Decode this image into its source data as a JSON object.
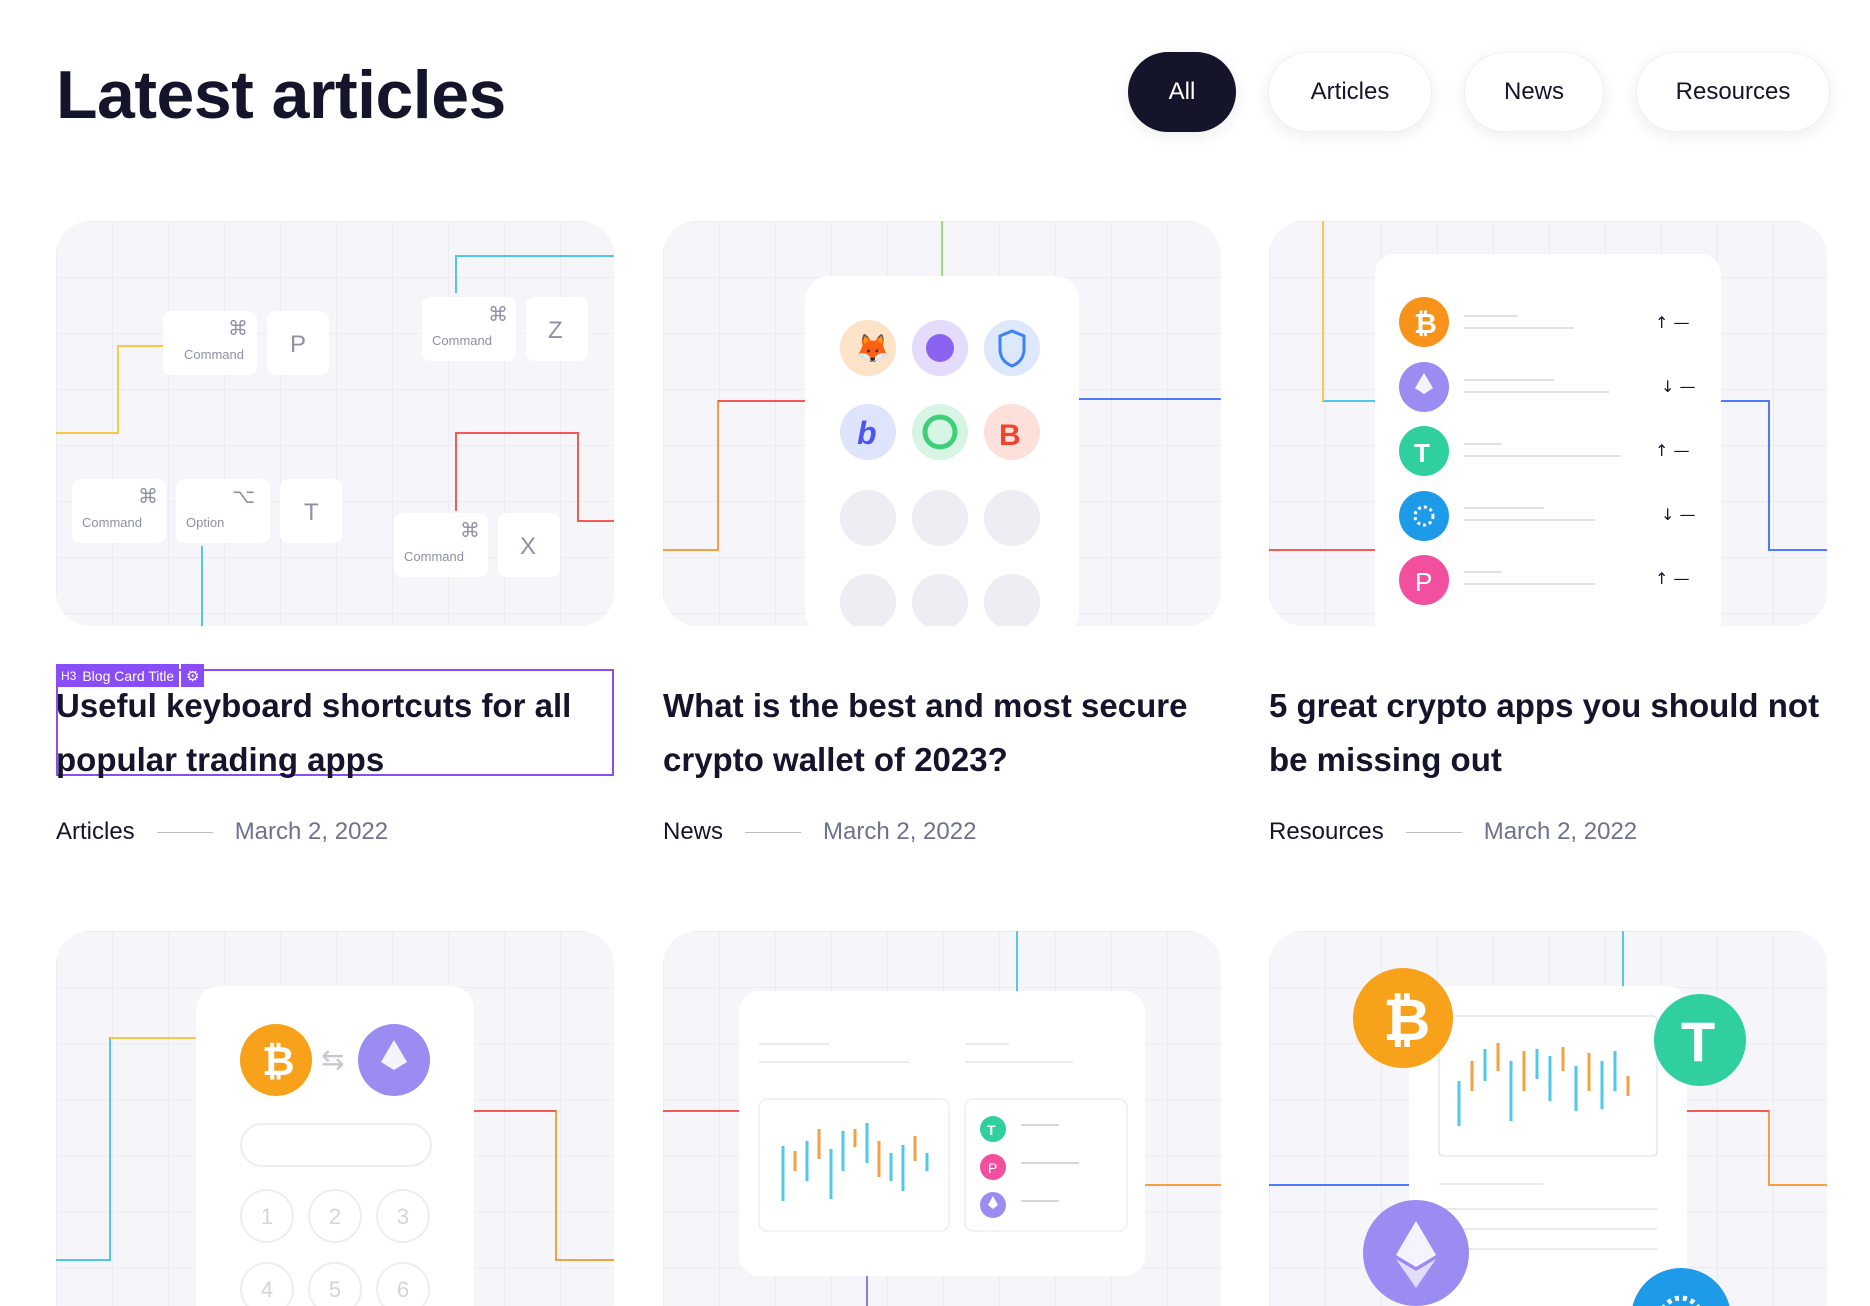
{
  "page": {
    "title": "Latest articles"
  },
  "filters": [
    {
      "label": "All",
      "active": true
    },
    {
      "label": "Articles",
      "active": false
    },
    {
      "label": "News",
      "active": false
    },
    {
      "label": "Resources",
      "active": false
    }
  ],
  "editor": {
    "tag": "H3",
    "label": "Blog Card Title",
    "icon": "gear-icon",
    "accent": "#8a4cf7"
  },
  "cards": [
    {
      "title": "Useful keyboard shortcuts for all popular trading apps",
      "category": "Articles",
      "date": "March 2, 2022",
      "keys": {
        "command": "Command",
        "option": "Option",
        "cmd_symbol": "⌘",
        "opt_symbol": "⌥",
        "p": "P",
        "z": "Z",
        "t": "T",
        "x": "X"
      }
    },
    {
      "title": "What is the best and most secure crypto wallet of 2023?",
      "category": "News",
      "date": "March 2, 2022"
    },
    {
      "title": "5 great crypto apps you should not be missing out",
      "category": "Resources",
      "date": "March 2, 2022"
    },
    {
      "title": "",
      "category": "",
      "date": "",
      "keypad": [
        "1",
        "2",
        "3",
        "4",
        "5",
        "6"
      ]
    },
    {
      "title": "",
      "category": "",
      "date": ""
    },
    {
      "title": "",
      "category": "",
      "date": ""
    }
  ],
  "colors": {
    "dark": "#14142b",
    "muted": "#6e7191",
    "bitcoin": "#f7931a",
    "ethereum": "#8c7cf0",
    "tether": "#26c6a6",
    "cardano": "#1e90ff",
    "polkadot": "#e6007a",
    "line_red": "#f25c54",
    "line_yellow": "#f7c948",
    "line_blue": "#4f7cff",
    "line_cyan": "#4ec9e8",
    "line_green": "#a3d977",
    "line_orange": "#f5a142"
  }
}
